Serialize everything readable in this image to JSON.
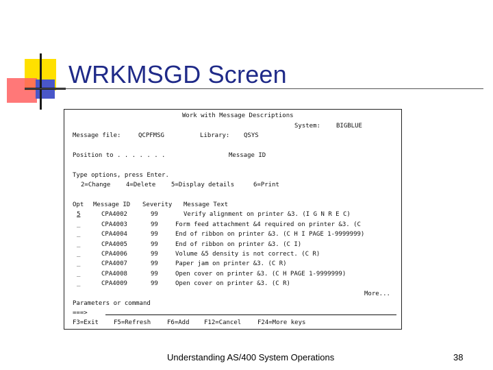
{
  "slide": {
    "title": "WRKMSGD Screen",
    "footer": "Understanding AS/400 System Operations",
    "page_number": "38"
  },
  "screen": {
    "header": "Work with Message Descriptions",
    "system_label": "System:",
    "system_value": "BIGBLUE",
    "message_file_label": "Message file:",
    "message_file_value": "QCPFMSG",
    "library_label": "Library:",
    "library_value": "QSYS",
    "position_to_label": "Position to . . . . . . .",
    "message_id_label": "Message ID",
    "type_options": "Type options, press Enter.",
    "options": [
      "2=Change",
      "4=Delete",
      "5=Display details",
      "6=Print"
    ],
    "columns": [
      "Opt",
      "Message ID",
      "Severity",
      "Message Text"
    ],
    "rows": [
      {
        "opt": "5",
        "id": "CPA4002",
        "severity": "99",
        "text": "Verify alignment on printer &3. (I G N R E C)"
      },
      {
        "opt": "_",
        "id": "CPA4003",
        "severity": "99",
        "text": "Form feed attachment &4 required on printer &3. (C"
      },
      {
        "opt": "_",
        "id": "CPA4004",
        "severity": "99",
        "text": "End of ribbon on printer &3. (C H I PAGE 1-9999999)"
      },
      {
        "opt": "_",
        "id": "CPA4005",
        "severity": "99",
        "text": "End of ribbon on printer &3. (C I)"
      },
      {
        "opt": "_",
        "id": "CPA4006",
        "severity": "99",
        "text": "Volume &5 density is not correct. (C R)"
      },
      {
        "opt": "_",
        "id": "CPA4007",
        "severity": "99",
        "text": "Paper jam on printer &3. (C R)"
      },
      {
        "opt": "_",
        "id": "CPA4008",
        "severity": "99",
        "text": "Open cover on printer &3. (C H PAGE 1-9999999)"
      },
      {
        "opt": "_",
        "id": "CPA4009",
        "severity": "99",
        "text": "Open cover on printer &3. (C R)"
      }
    ],
    "more": "More...",
    "parameters_label": "Parameters or command",
    "prompt": "===>",
    "function_keys": [
      "F3=Exit",
      "F5=Refresh",
      "F6=Add",
      "F12=Cancel",
      "F24=More keys"
    ]
  }
}
